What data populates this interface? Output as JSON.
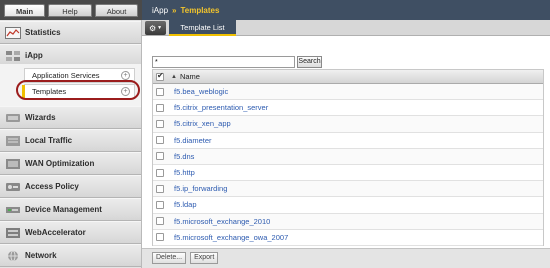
{
  "topnav": {
    "tabs": [
      "Main",
      "Help",
      "About"
    ]
  },
  "sidebar": {
    "sections": [
      {
        "label": "Statistics",
        "icon": "statistics-icon"
      },
      {
        "label": "iApp",
        "icon": "iapp-icon"
      },
      {
        "label": "Wizards",
        "icon": "wizards-icon"
      },
      {
        "label": "Local Traffic",
        "icon": "local-traffic-icon"
      },
      {
        "label": "WAN Optimization",
        "icon": "wan-optimization-icon"
      },
      {
        "label": "Access Policy",
        "icon": "access-policy-icon"
      },
      {
        "label": "Device Management",
        "icon": "device-management-icon"
      },
      {
        "label": "WebAccelerator",
        "icon": "webaccelerator-icon"
      },
      {
        "label": "Network",
        "icon": "network-icon"
      }
    ],
    "iapp_items": [
      {
        "label": "Application Services"
      },
      {
        "label": "Templates"
      }
    ]
  },
  "header": {
    "crumb1": "iApp",
    "separator": "»",
    "crumb2": "Templates"
  },
  "toolbar": {
    "tab_label": "Template List"
  },
  "search": {
    "value": "*",
    "button": "Search"
  },
  "table": {
    "header": "Name",
    "rows": [
      "f5.bea_weblogic",
      "f5.citrix_presentation_server",
      "f5.citrix_xen_app",
      "f5.diameter",
      "f5.dns",
      "f5.http",
      "f5.ip_forwarding",
      "f5.ldap",
      "f5.microsoft_exchange_2010",
      "f5.microsoft_exchange_owa_2007"
    ]
  },
  "footer": {
    "delete": "Delete...",
    "export": "Export"
  },
  "colors": {
    "header_bg": "#3f4f63",
    "accent": "#f3c52c",
    "link": "#2d5bb0",
    "highlight_ring": "#9b1c1c"
  }
}
